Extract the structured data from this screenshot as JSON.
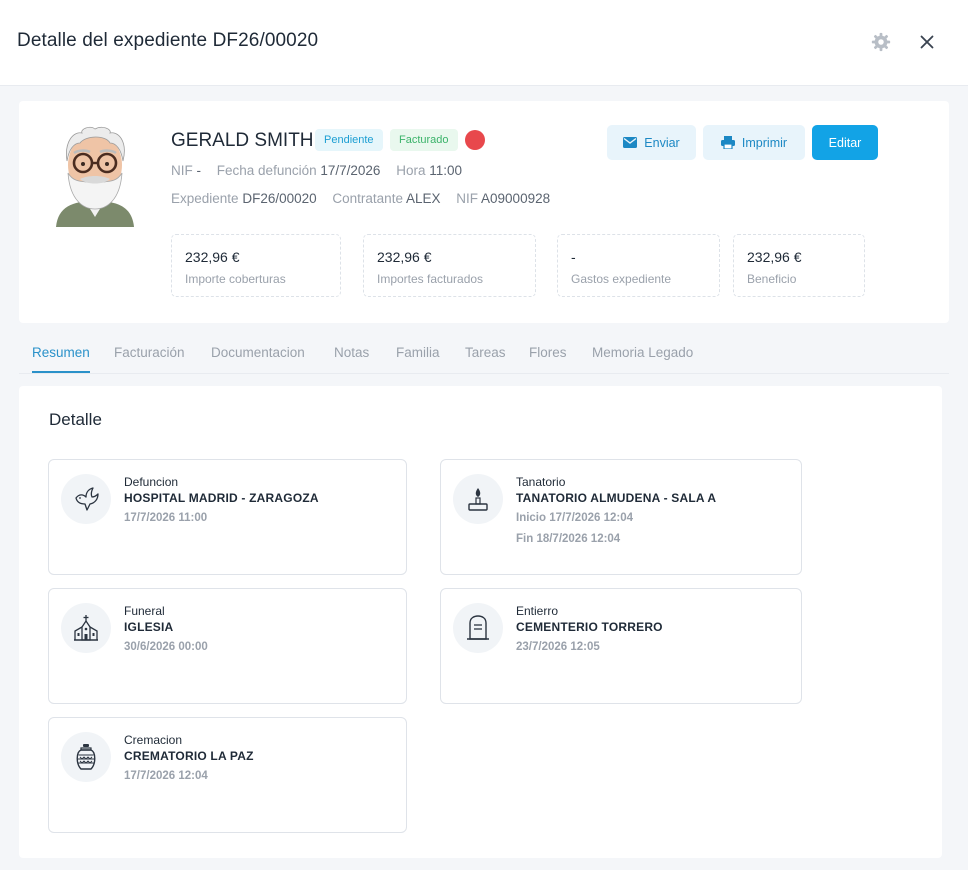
{
  "header": {
    "title": "Detalle del expediente DF26/00020"
  },
  "profile": {
    "name": "GERALD SMITH",
    "badges": {
      "pending": "Pendiente",
      "invoiced": "Facturado"
    },
    "status_dot_color": "#e8484c",
    "nif_label": "NIF",
    "nif_value": "-",
    "death_date_label": "Fecha defunción",
    "death_date_value": "17/7/2026",
    "time_label": "Hora",
    "time_value": "11:00",
    "file_label": "Expediente",
    "file_value": "DF26/00020",
    "contractor_label": "Contratante",
    "contractor_value": "ALEX",
    "contractor_nif_label": "NIF",
    "contractor_nif_value": "A09000928"
  },
  "actions": {
    "send": "Enviar",
    "print": "Imprimir",
    "edit": "Editar"
  },
  "stats": [
    {
      "value": "232,96 €",
      "label": "Importe coberturas"
    },
    {
      "value": "232,96 €",
      "label": "Importes facturados"
    },
    {
      "value": "-",
      "label": "Gastos expediente"
    },
    {
      "value": "232,96 €",
      "label": "Beneficio"
    }
  ],
  "tabs": [
    "Resumen",
    "Facturación",
    "Documentacion",
    "Notas",
    "Familia",
    "Tareas",
    "Flores",
    "Memoria Legado"
  ],
  "active_tab": "Resumen",
  "detail": {
    "title": "Detalle",
    "events": [
      {
        "type": "Defuncion",
        "place": "HOSPITAL MADRID - ZARAGOZA",
        "line1": "17/7/2026 11:00",
        "line2": "",
        "icon": "dove-icon"
      },
      {
        "type": "Tanatorio",
        "place": "TANATORIO ALMUDENA - SALA A",
        "line1": "Inicio 17/7/2026 12:04",
        "line2": "Fin 18/7/2026 12:04",
        "icon": "candle-icon"
      },
      {
        "type": "Funeral",
        "place": "IGLESIA",
        "line1": "30/6/2026 00:00",
        "line2": "",
        "icon": "church-icon"
      },
      {
        "type": "Entierro",
        "place": "CEMENTERIO TORRERO",
        "line1": "23/7/2026 12:05",
        "line2": "",
        "icon": "tombstone-icon"
      },
      {
        "type": "Cremacion",
        "place": "CREMATORIO LA PAZ",
        "line1": "17/7/2026 12:04",
        "line2": "",
        "icon": "urn-icon"
      }
    ]
  },
  "colors": {
    "accent": "#12a3e6",
    "tab_active": "#2a91c9",
    "badge_pending": "#1c9ed3",
    "badge_invoiced": "#3bb36a"
  }
}
